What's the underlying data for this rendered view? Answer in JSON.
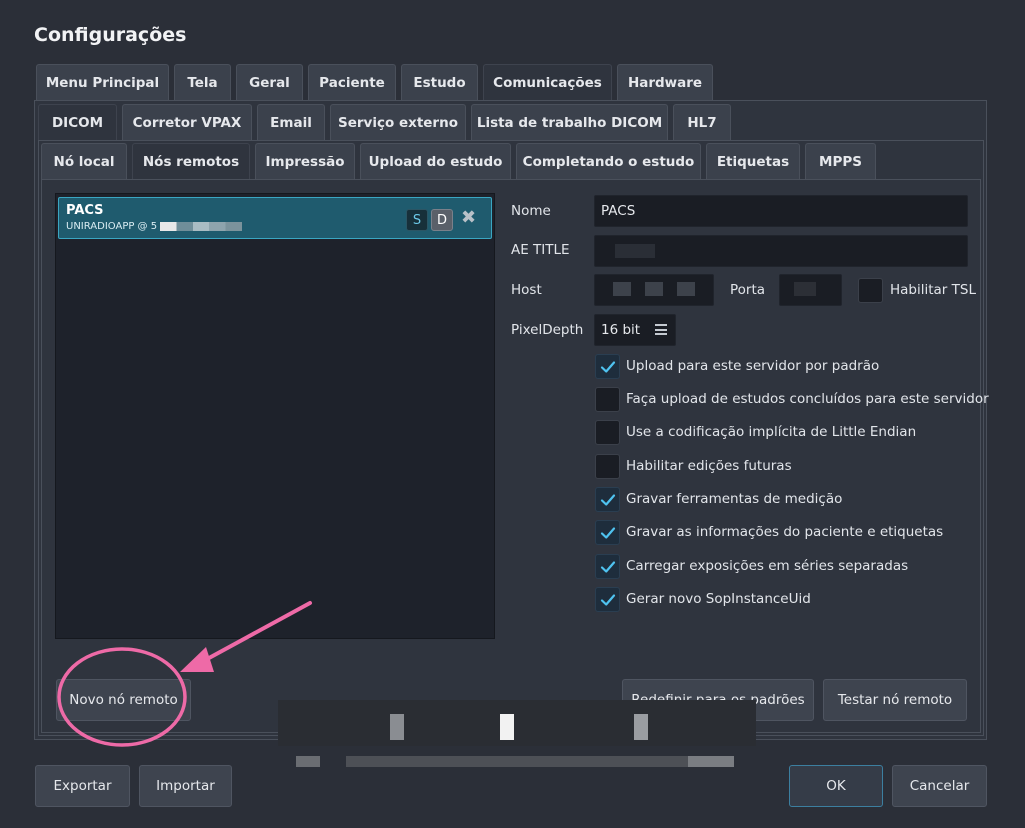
{
  "window": {
    "title": "Configurações"
  },
  "tabs_row1": [
    "Menu Principal",
    "Tela",
    "Geral",
    "Paciente",
    "Estudo",
    "Comunicações",
    "Hardware"
  ],
  "tabs_row2": [
    "DICOM",
    "Corretor VPAX",
    "Email",
    "Serviço externo",
    "Lista de trabalho DICOM",
    "HL7"
  ],
  "tabs_row3": [
    "Nó local",
    "Nós remotos",
    "Impressão",
    "Upload do estudo",
    "Completando o estudo",
    "Etiquetas",
    "MPPS"
  ],
  "remote_list": {
    "items": [
      {
        "name": "PACS",
        "subtitle": "UNIRADIOAPP @ 5",
        "badge_s": "S",
        "badge_d": "D"
      }
    ]
  },
  "form": {
    "name_label": "Nome",
    "name_value": "PACS",
    "aetitle_label": "AE TITLE",
    "host_label": "Host",
    "port_label": "Porta",
    "tls_label": "Habilitar TSL",
    "pixeldepth_label": "PixelDepth",
    "pixeldepth_value": "16 bit"
  },
  "options": [
    {
      "label": "Upload para este servidor por padrão",
      "checked": true
    },
    {
      "label": "Faça upload de estudos concluídos para este servidor",
      "checked": false
    },
    {
      "label": "Use a codificação implícita de Little Endian",
      "checked": false
    },
    {
      "label": "Habilitar edições futuras",
      "checked": false
    },
    {
      "label": "Gravar ferramentas de medição",
      "checked": true
    },
    {
      "label": "Gravar as informações do paciente e etiquetas",
      "checked": true
    },
    {
      "label": "Carregar exposições em séries separadas",
      "checked": true
    },
    {
      "label": "Gerar novo SopInstanceUid",
      "checked": true
    }
  ],
  "buttons": {
    "new_remote": "Novo nó remoto",
    "reset_defaults": "Redefinir para os padrões",
    "test_remote": "Testar nó remoto",
    "export": "Exportar",
    "import": "Importar",
    "ok": "OK",
    "cancel": "Cancelar"
  },
  "colors": {
    "accent": "#3aa6c2",
    "check": "#4fc3f0",
    "annotation": "#ee6aa7"
  }
}
